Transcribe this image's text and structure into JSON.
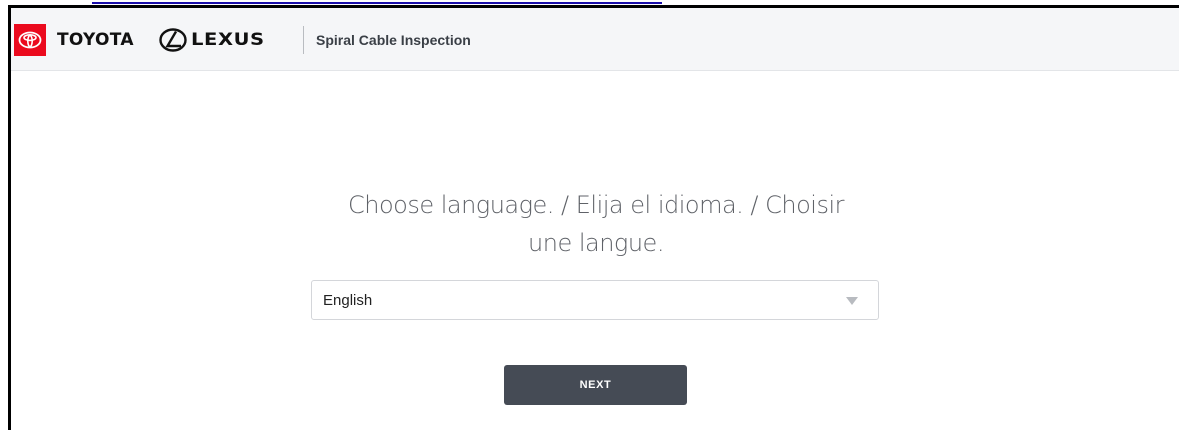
{
  "header": {
    "brand_primary": "TOYOTA",
    "brand_secondary": "LEXUS",
    "app_title": "Spiral Cable Inspection",
    "toyota_icon": "toyota-emblem-icon",
    "lexus_icon": "lexus-emblem-icon",
    "toyota_color": "#eb0a1e"
  },
  "main": {
    "prompt_line1": "Choose language. / Elija el idioma. / Choisir",
    "prompt_line2": "une langue.",
    "language_select": {
      "selected": "English",
      "caret_icon": "chevron-down-icon"
    },
    "next_label": "NEXT"
  },
  "colors": {
    "header_bg": "#f5f6f8",
    "button_bg": "#454b55",
    "link": "#1a0dab"
  }
}
